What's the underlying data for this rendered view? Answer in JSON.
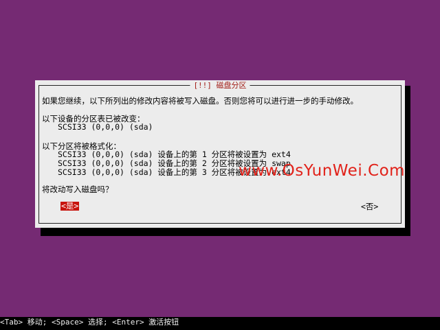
{
  "dialog": {
    "title": "[!!] 磁盘分区",
    "intro": "如果您继续，以下所列出的修改内容将被写入磁盘。否则您将可以进行进一步的手动修改。",
    "changed_heading": "以下设备的分区表已被改变：",
    "changed_devices": [
      "SCSI33 (0,0,0) (sda)"
    ],
    "format_heading": "以下分区将被格式化：",
    "format_lines": [
      "SCSI33 (0,0,0) (sda) 设备上的第 1 分区将被设置为 ext4",
      "SCSI33 (0,0,0) (sda) 设备上的第 2 分区将被设置为 swap",
      "SCSI33 (0,0,0) (sda) 设备上的第 3 分区将被设置为 ext4"
    ],
    "question": "将改动写入磁盘吗？",
    "yes_label": "<是>",
    "no_label": "<否>"
  },
  "statusbar": {
    "text": "<Tab> 移动; <Space> 选择; <Enter> 激活按钮"
  },
  "watermark": "www.OsYunWei.Com",
  "colors": {
    "background": "#752a73",
    "dialog": "#ececec",
    "title": "#a11a14",
    "selected_button": "#c8140d",
    "watermark": "#e1221a"
  }
}
